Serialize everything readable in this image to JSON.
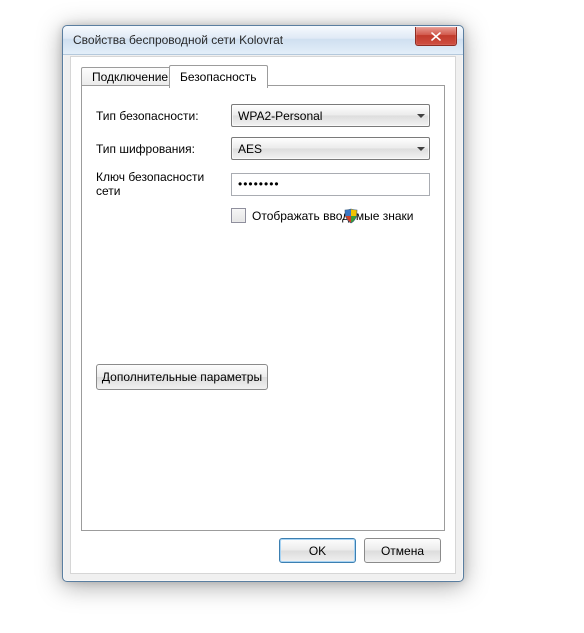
{
  "window": {
    "title": "Свойства беспроводной сети Kolovrat"
  },
  "tabs": {
    "connection": "Подключение",
    "security": "Безопасность"
  },
  "form": {
    "securityTypeLabel": "Тип безопасности:",
    "securityTypeValue": "WPA2-Personal",
    "encryptionLabel": "Тип шифрования:",
    "encryptionValue": "AES",
    "keyLabel": "Ключ безопасности сети",
    "keyValue": "••••••••",
    "showCharsLabel": "Отображать вводимые знаки",
    "showCharsChecked": false,
    "advancedLabel": "Дополнительные параметры"
  },
  "buttons": {
    "ok": "OK",
    "cancel": "Отмена"
  },
  "icons": {
    "close": "close-icon",
    "shield": "uac-shield-icon",
    "dropdown": "chevron-down-icon"
  },
  "annotation": {
    "color": "#d40000"
  }
}
